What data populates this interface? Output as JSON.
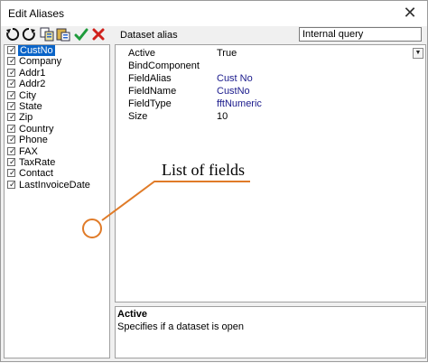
{
  "window": {
    "title": "Edit Aliases",
    "close_glyph": "✕"
  },
  "toolbar": {
    "buttons": [
      {
        "icon": "refresh-icon",
        "label": ""
      },
      {
        "icon": "undo-icon",
        "label": ""
      },
      {
        "icon": "copy-icon",
        "label": ""
      },
      {
        "icon": "paste-icon",
        "label": ""
      },
      {
        "icon": "check-icon",
        "label": ""
      },
      {
        "icon": "close-icon",
        "label": ""
      }
    ]
  },
  "fields": {
    "items": [
      {
        "label": "CustNo",
        "checked": true,
        "selected": true
      },
      {
        "label": "Company",
        "checked": true
      },
      {
        "label": "Addr1",
        "checked": true
      },
      {
        "label": "Addr2",
        "checked": true
      },
      {
        "label": "City",
        "checked": true
      },
      {
        "label": "State",
        "checked": true
      },
      {
        "label": "Zip",
        "checked": true
      },
      {
        "label": "Country",
        "checked": true
      },
      {
        "label": "Phone",
        "checked": true
      },
      {
        "label": "FAX",
        "checked": true
      },
      {
        "label": "TaxRate",
        "checked": true
      },
      {
        "label": "Contact",
        "checked": true
      },
      {
        "label": "LastInvoiceDate",
        "checked": true
      }
    ]
  },
  "dataset": {
    "label": "Dataset alias",
    "value": "Internal query"
  },
  "properties": [
    {
      "name": "Active",
      "value": "True",
      "dropdown": true,
      "plain": true
    },
    {
      "name": "BindComponent",
      "value": ""
    },
    {
      "name": "FieldAlias",
      "value": "Cust No"
    },
    {
      "name": "FieldName",
      "value": "CustNo"
    },
    {
      "name": "FieldType",
      "value": "fftNumeric"
    },
    {
      "name": "Size",
      "value": "10",
      "plain": true
    }
  ],
  "help": {
    "title": "Active",
    "description": "Specifies if a dataset is open"
  },
  "annotation": {
    "text": "List of fields",
    "color": "#e07b28"
  },
  "colors": {
    "selection": "#0a64c8",
    "check_green": "#1e9b3b",
    "cancel_red": "#d0211c"
  }
}
